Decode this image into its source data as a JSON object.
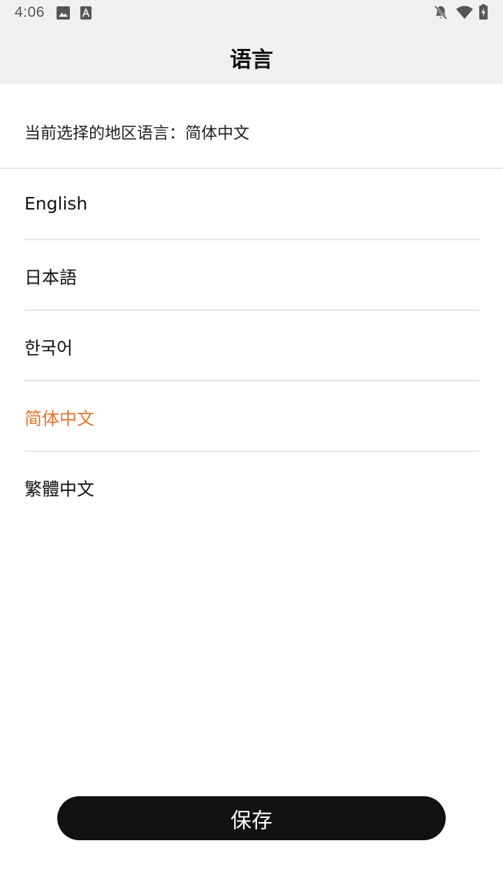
{
  "status_bar": {
    "time": "4:06",
    "left_icons": [
      "image-icon",
      "text-a-icon"
    ],
    "right_icons": [
      "notifications-off-icon",
      "wifi-icon",
      "battery-charging-icon"
    ]
  },
  "header": {
    "title": "语言"
  },
  "current": {
    "text": "当前选择的地区语言：简体中文"
  },
  "languages": [
    {
      "label": "English",
      "selected": false
    },
    {
      "label": "日本語",
      "selected": false
    },
    {
      "label": "한국어",
      "selected": false
    },
    {
      "label": "简体中文",
      "selected": true
    },
    {
      "label": "繁體中文",
      "selected": false
    }
  ],
  "save_label": "保存",
  "colors": {
    "accent": "#e8732a",
    "header_bg": "#f0f0f0",
    "button_bg": "#111111",
    "divider": "#e6e6e6"
  }
}
